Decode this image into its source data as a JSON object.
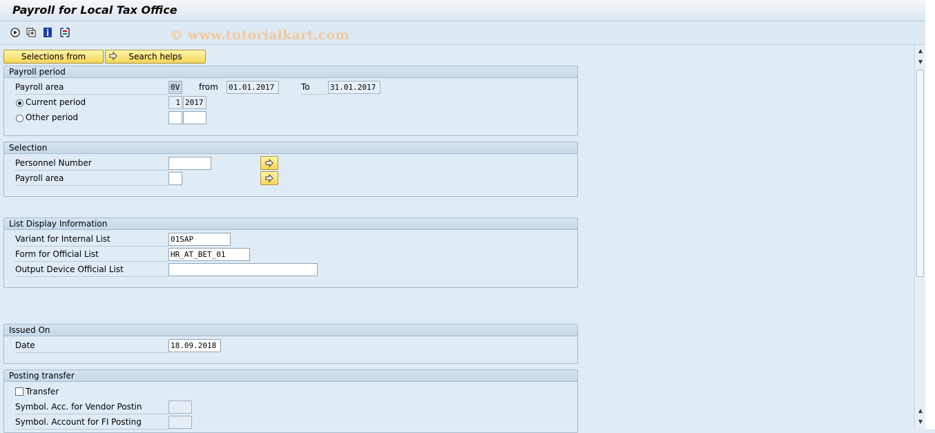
{
  "window": {
    "title": "Payroll for Local Tax Office"
  },
  "toolbar": {
    "icons": [
      "execute-icon",
      "get-variant-icon",
      "info-icon",
      "selection-options-icon"
    ],
    "watermark": "© www.tutorialkart.com"
  },
  "buttons": {
    "selections_from": "Selections from",
    "search_helps": "Search helps"
  },
  "payroll_period": {
    "header": "Payroll period",
    "payroll_area_label": "Payroll area",
    "payroll_area_value": "0V",
    "from_label": "from",
    "from_value": "01.01.2017",
    "to_label": "To",
    "to_value": "31.01.2017",
    "current_period_label": "Current period",
    "current_period_num": "1",
    "current_period_year": "2017",
    "other_period_label": "Other period",
    "other_period_num": "",
    "other_period_year": ""
  },
  "selection": {
    "header": "Selection",
    "personnel_number_label": "Personnel Number",
    "personnel_number_value": "",
    "payroll_area_label": "Payroll area",
    "payroll_area_value": ""
  },
  "list_display": {
    "header": "List Display Information",
    "variant_label": "Variant for Internal List",
    "variant_value": "01SAP",
    "form_label": "Form for Official List",
    "form_value": "HR_AT_BET_01",
    "output_label": "Output Device Official List",
    "output_value": ""
  },
  "issued_on": {
    "header": "Issued On",
    "date_label": "Date",
    "date_value": "18.09.2018"
  },
  "posting_transfer": {
    "header": "Posting transfer",
    "transfer_label": "Transfer",
    "vendor_label": "Symbol. Acc. for Vendor Postin",
    "vendor_value": "",
    "fi_label": "Symbol. Account for FI Posting",
    "fi_value": ""
  },
  "colors": {
    "background": "#dfebf5",
    "button_yellow": "#f5d65a",
    "watermark": "#f1c9a0"
  }
}
